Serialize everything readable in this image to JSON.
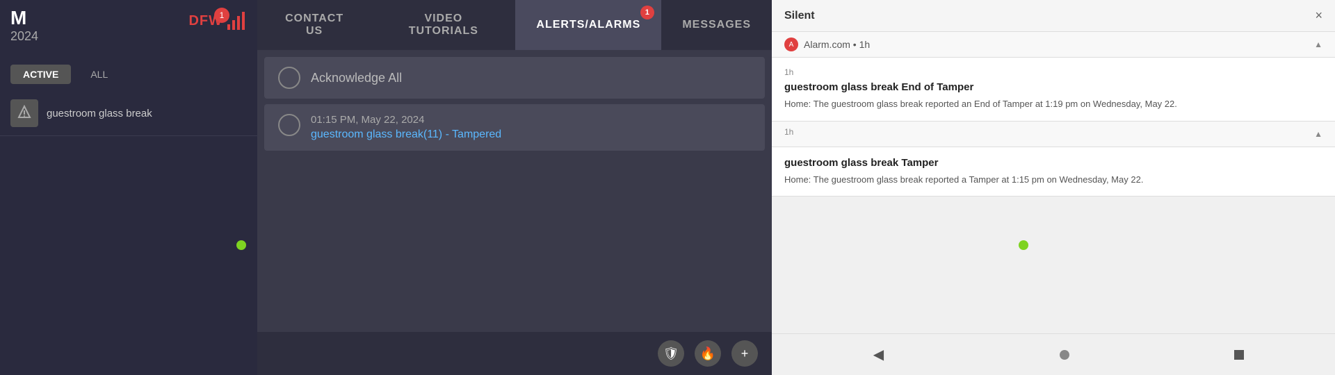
{
  "leftPanel": {
    "title": "M",
    "date": "2024",
    "logo": "DFW",
    "logoBadge": "1",
    "filterActive": "ACTIVE",
    "filterAll": "ALL",
    "alertItem": {
      "text": "guestroom glass break",
      "iconLabel": "alert-icon"
    }
  },
  "middlePanel": {
    "tabs": [
      {
        "id": "contact",
        "label": "CONTACT US",
        "badge": null
      },
      {
        "id": "video",
        "label": "VIDEO TUTORIALS",
        "badge": null
      },
      {
        "id": "alerts",
        "label": "ALERTS/ALARMS",
        "badge": "1",
        "active": true
      },
      {
        "id": "messages",
        "label": "MESSAGES",
        "badge": null
      }
    ],
    "acknowledgeAll": "Acknowledge All",
    "alertEvent": {
      "timestamp": "01:15 PM, May 22, 2024",
      "eventName": "guestroom glass break(11) - Tampered"
    },
    "footerIcons": [
      {
        "id": "shield",
        "symbol": "🛡"
      },
      {
        "id": "fire",
        "symbol": "🔥"
      },
      {
        "id": "plus",
        "symbol": "+"
      }
    ]
  },
  "rightPanel": {
    "title": "Silent",
    "closeBtn": "×",
    "source": {
      "name": "Alarm.com",
      "time": "• 1h"
    },
    "notifications": [
      {
        "time": "1h",
        "title": "guestroom glass break End of Tamper",
        "body": "Home: The guestroom glass break reported an End of Tamper at 1:19 pm on Wednesday, May 22."
      },
      {
        "time": "1h",
        "title": "guestroom glass break Tamper",
        "body": "Home: The guestroom glass break reported a Tamper at 1:15 pm on Wednesday, May 22."
      }
    ],
    "footer": {
      "back": "◀",
      "circle": "",
      "square": ""
    }
  }
}
